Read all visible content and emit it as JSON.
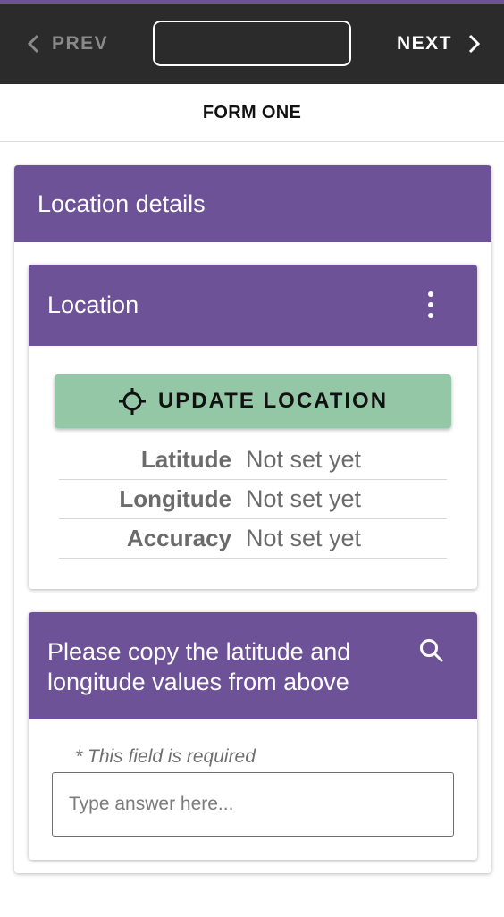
{
  "colors": {
    "accent": "#6e5298",
    "topbar": "#2b2b2b",
    "update_button": "#93c7a6"
  },
  "nav": {
    "prev_label": "PREV",
    "next_label": "NEXT",
    "prev_icon": "chevron-left-icon",
    "next_icon": "chevron-right-icon",
    "page_select_value": ""
  },
  "form": {
    "title": "FORM ONE"
  },
  "section": {
    "title": "Location details",
    "location_field": {
      "title": "Location",
      "menu_icon": "more-vertical-icon",
      "update_button": {
        "label": "UPDATE LOCATION",
        "icon": "crosshair-icon"
      },
      "rows": [
        {
          "label": "Latitude",
          "value": "Not set yet"
        },
        {
          "label": "Longitude",
          "value": "Not set yet"
        },
        {
          "label": "Accuracy",
          "value": "Not set yet"
        }
      ]
    },
    "copy_field": {
      "title": "Please copy the latitude and longitude values from above",
      "search_icon": "search-icon",
      "required_note": "* This field is required",
      "input_value": "",
      "input_placeholder": "Type answer here..."
    }
  }
}
